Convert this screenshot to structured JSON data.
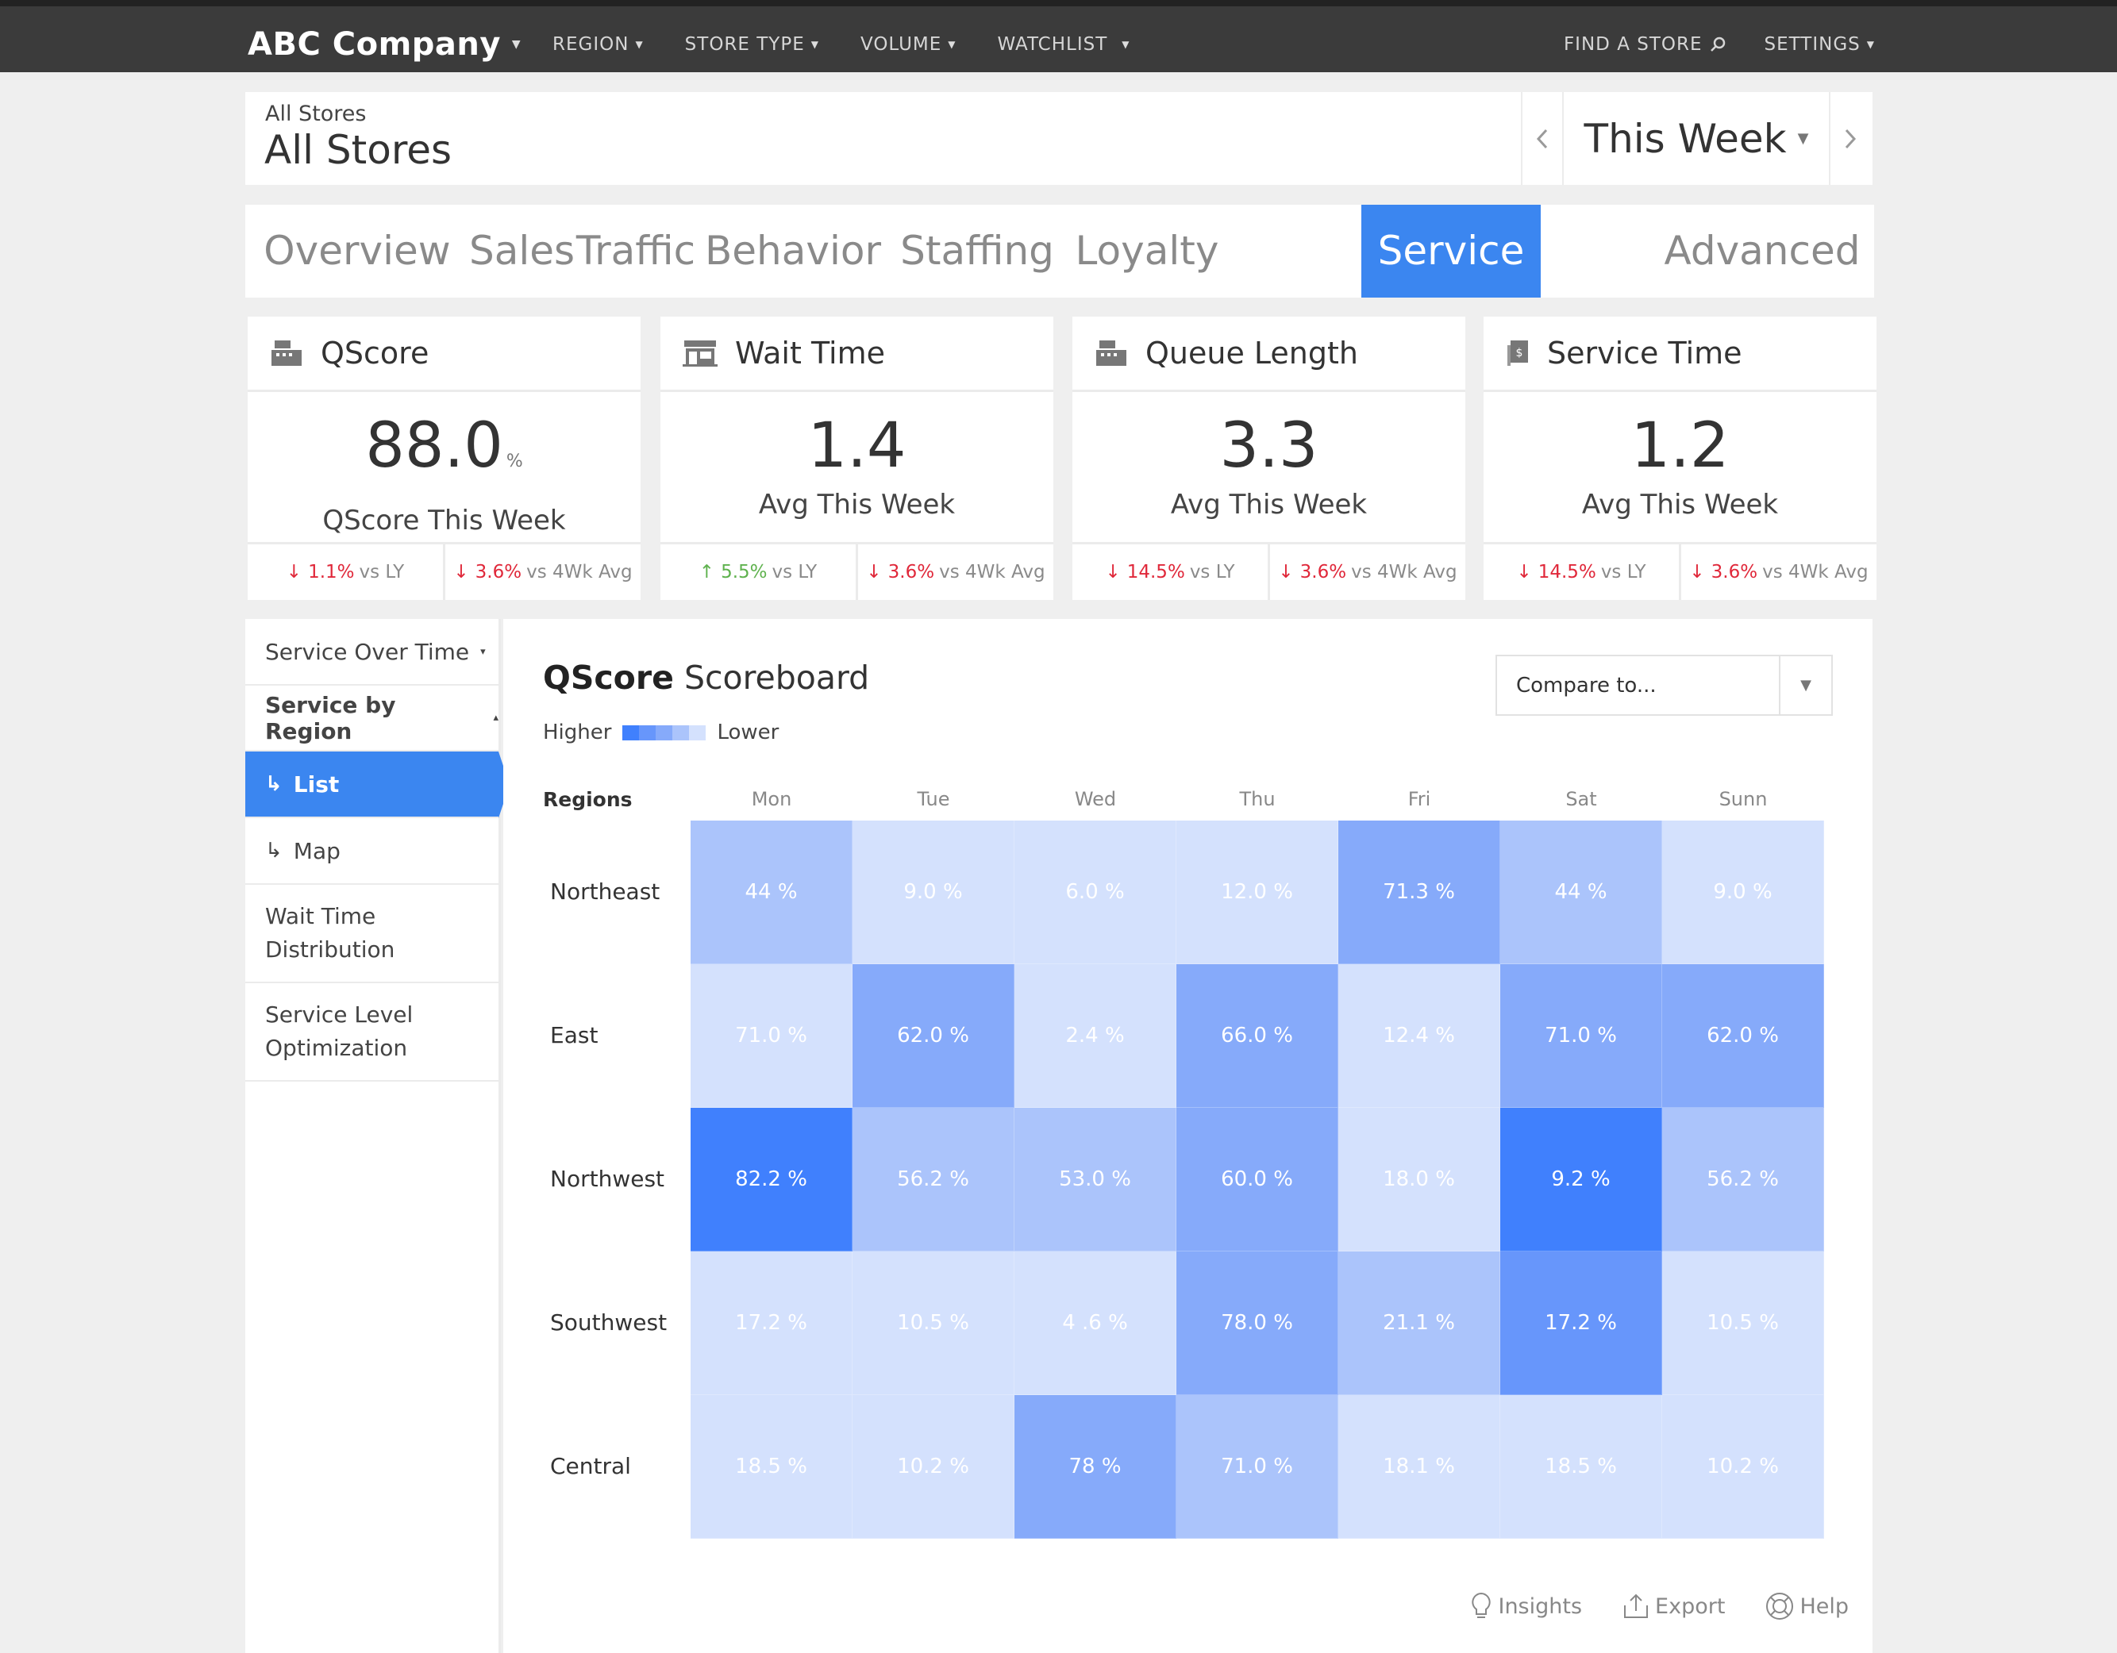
{
  "nav": {
    "brand": "ABC Company",
    "items": [
      "REGION",
      "STORE TYPE",
      "VOLUME",
      "WATCHLIST"
    ],
    "find_store": "FIND A STORE",
    "settings": "SETTINGS"
  },
  "header": {
    "breadcrumb": "All Stores",
    "title": "All Stores",
    "period": "This Week"
  },
  "tabs": [
    "Overview",
    "Sales",
    "Traffic",
    "Behavior",
    "Staffing",
    "Loyalty",
    "Service",
    "Advanced"
  ],
  "active_tab": "Service",
  "cards": [
    {
      "title": "QScore",
      "icon": "register-icon",
      "value": "88.0",
      "unit": "%",
      "subtitle": "QScore This Week",
      "vs_ly": "1.1%",
      "vs_ly_dir": "down",
      "vs_ly_label": "vs LY",
      "vs_4wk": "3.6%",
      "vs_4wk_dir": "down",
      "vs_4wk_label": "vs 4Wk Avg"
    },
    {
      "title": "Wait Time",
      "icon": "storefront-icon",
      "value": "1.4",
      "unit": "",
      "subtitle": "Avg This Week",
      "vs_ly": "5.5%",
      "vs_ly_dir": "up",
      "vs_ly_label": "vs LY",
      "vs_4wk": "3.6%",
      "vs_4wk_dir": "down",
      "vs_4wk_label": "vs 4Wk Avg"
    },
    {
      "title": "Queue Length",
      "icon": "register-icon",
      "value": "3.3",
      "unit": "",
      "subtitle": "Avg This Week",
      "vs_ly": "14.5%",
      "vs_ly_dir": "down",
      "vs_ly_label": "vs LY",
      "vs_4wk": "3.6%",
      "vs_4wk_dir": "down",
      "vs_4wk_label": "vs 4Wk Avg"
    },
    {
      "title": "Service Time",
      "icon": "receipt-icon",
      "value": "1.2",
      "unit": "",
      "subtitle": "Avg This Week",
      "vs_ly": "14.5%",
      "vs_ly_dir": "down",
      "vs_ly_label": "vs LY",
      "vs_4wk": "3.6%",
      "vs_4wk_dir": "down",
      "vs_4wk_label": "vs 4Wk Avg"
    }
  ],
  "sidebar": {
    "items": [
      {
        "label": "Service Over Time",
        "caret": "▾",
        "style": "normal"
      },
      {
        "label": "Service by Region",
        "caret": "▴",
        "style": "bold"
      },
      {
        "label": "List",
        "style": "active",
        "sub": true
      },
      {
        "label": "Map",
        "style": "normal",
        "sub": true
      },
      {
        "label": "Wait Time\nDistribution",
        "style": "normal"
      },
      {
        "label": "Service Level\nOptimization",
        "style": "normal"
      }
    ]
  },
  "scoreboard": {
    "title_bold": "QScore",
    "title_rest": "Scoreboard",
    "legend_high": "Higher",
    "legend_low": "Lower",
    "compare_placeholder": "Compare to...",
    "regions_header": "Regions",
    "days": [
      "Mon",
      "Tue",
      "Wed",
      "Thu",
      "Fri",
      "Sat",
      "Sunn"
    ],
    "regions": [
      "Northeast",
      "East",
      "Northwest",
      "Southwest",
      "Central"
    ],
    "cells": [
      [
        {
          "v": "44 %",
          "c": "#abc4fb"
        },
        {
          "v": "9.0 %",
          "c": "#d4e1fd"
        },
        {
          "v": "6.0 %",
          "c": "#d4e1fd"
        },
        {
          "v": "12.0 %",
          "c": "#d4e1fd"
        },
        {
          "v": "71.3 %",
          "c": "#86aafa"
        },
        {
          "v": "44 %",
          "c": "#abc4fb"
        },
        {
          "v": "9.0 %",
          "c": "#d4e1fd"
        }
      ],
      [
        {
          "v": "71.0 %",
          "c": "#d4e1fd"
        },
        {
          "v": "62.0 %",
          "c": "#86aafa"
        },
        {
          "v": "2.4 %",
          "c": "#d4e1fd"
        },
        {
          "v": "66.0 %",
          "c": "#86aafa"
        },
        {
          "v": "12.4 %",
          "c": "#d4e1fd"
        },
        {
          "v": "71.0 %",
          "c": "#86aafa"
        },
        {
          "v": "62.0 %",
          "c": "#86aafa"
        }
      ],
      [
        {
          "v": "82.2 %",
          "c": "#4080fd"
        },
        {
          "v": "56.2 %",
          "c": "#abc4fb"
        },
        {
          "v": "53.0 %",
          "c": "#abc4fb"
        },
        {
          "v": "60.0 %",
          "c": "#86aafa"
        },
        {
          "v": "18.0 %",
          "c": "#d4e1fd"
        },
        {
          "v": "9.2 %",
          "c": "#4080fd"
        },
        {
          "v": "56.2 %",
          "c": "#abc4fb"
        }
      ],
      [
        {
          "v": "17.2 %",
          "c": "#d4e1fd"
        },
        {
          "v": "10.5 %",
          "c": "#d4e1fd"
        },
        {
          "v": "4 .6 %",
          "c": "#d4e1fd"
        },
        {
          "v": "78.0 %",
          "c": "#86aafa"
        },
        {
          "v": "21.1 %",
          "c": "#abc4fb"
        },
        {
          "v": "17.2 %",
          "c": "#6796fb"
        },
        {
          "v": "10.5 %",
          "c": "#d4e1fd"
        }
      ],
      [
        {
          "v": "18.5 %",
          "c": "#d4e1fd"
        },
        {
          "v": "10.2 %",
          "c": "#d4e1fd"
        },
        {
          "v": "78 %",
          "c": "#86aafa"
        },
        {
          "v": "71.0 %",
          "c": "#abc4fb"
        },
        {
          "v": "18.1 %",
          "c": "#d4e1fd"
        },
        {
          "v": "18.5 %",
          "c": "#d4e1fd"
        },
        {
          "v": "10.2 %",
          "c": "#d4e1fd"
        }
      ]
    ],
    "tools": [
      "Insights",
      "Export",
      "Help"
    ]
  },
  "colors": {
    "accent": "#3b86f0",
    "topbar": "#3b3b3b",
    "down": "#e0283a",
    "up": "#5fb24e"
  }
}
